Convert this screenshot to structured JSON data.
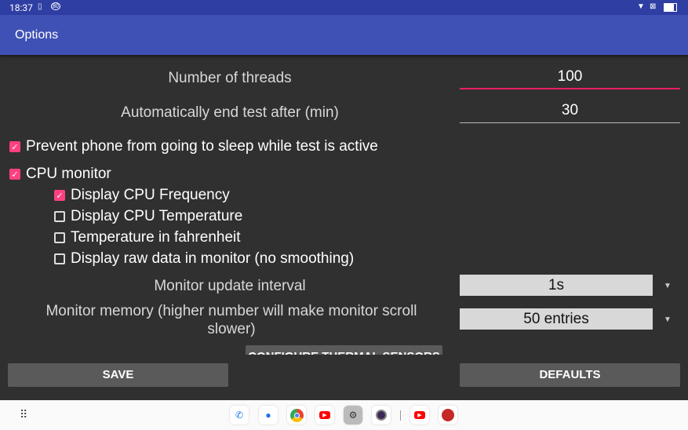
{
  "status_bar": {
    "time": "18:37",
    "battery_saver": "80"
  },
  "toolbar": {
    "title": "Options"
  },
  "options": {
    "threads_label": "Number of threads",
    "threads_value": "100",
    "end_label": "Automatically end test after (min)",
    "end_value": "30",
    "prevent_sleep": {
      "label": "Prevent phone from going to sleep while test is active",
      "checked": true
    },
    "cpu_monitor": {
      "label": "CPU monitor",
      "checked": true
    },
    "sub": [
      {
        "label": "Display CPU Frequency",
        "checked": true
      },
      {
        "label": "Display CPU Temperature",
        "checked": false
      },
      {
        "label": "Temperature in fahrenheit",
        "checked": false
      },
      {
        "label": "Display raw data in monitor (no smoothing)",
        "checked": false
      }
    ],
    "interval_label": "Monitor update interval",
    "interval_value": "1s",
    "memory_label": "Monitor memory (higher number will make monitor scroll slower)",
    "memory_value": "50 entries",
    "thermal_button": "CONFIGURE THERMAL SENSORS"
  },
  "buttons": {
    "save": "SAVE",
    "defaults": "DEFAULTS"
  },
  "colors": {
    "accent": "#ff4081",
    "primary": "#3f51b5",
    "background": "#303030"
  },
  "dock": [
    "phone",
    "messages",
    "chrome",
    "youtube",
    "settings",
    "camera",
    "youtube",
    "antutu"
  ]
}
